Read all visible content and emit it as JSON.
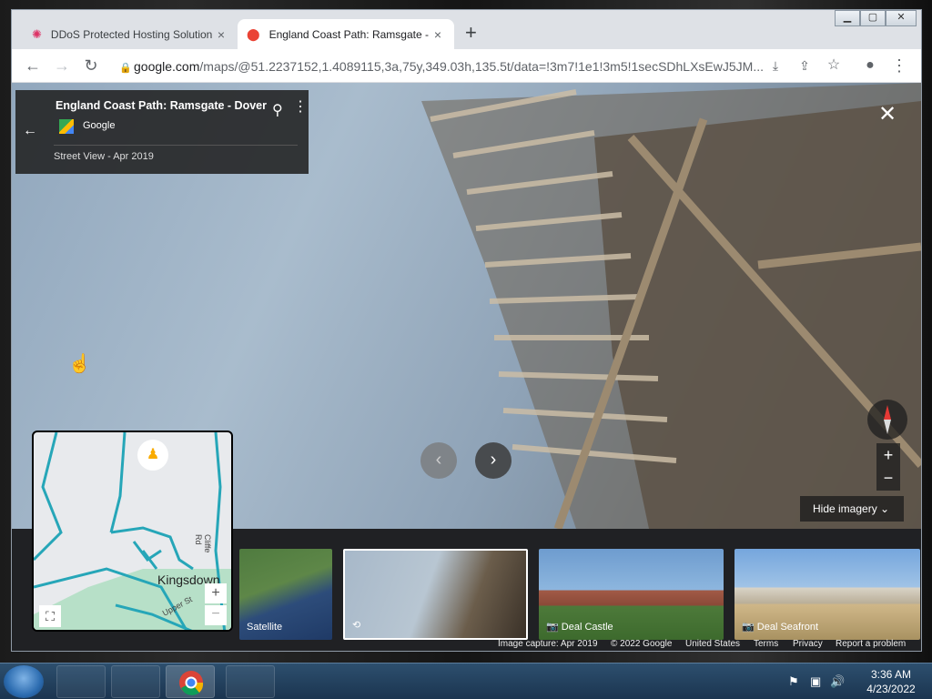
{
  "tabs": [
    {
      "title": "DDoS Protected Hosting Solution",
      "icon": "ddos-site-icon"
    },
    {
      "title": "England Coast Path: Ramsgate - D",
      "icon": "google-maps-icon"
    }
  ],
  "toolbar": {
    "url_host": "google.com",
    "url_path": "/maps/@51.2237152,1.4089115,3a,75y,349.03h,135.5t/data=!3m7!1e1!3m5!1secSDhLXsEwJ5JM..."
  },
  "info_card": {
    "title": "England Coast Path: Ramsgate - Dover",
    "source": "Google",
    "date": "Street View - Apr 2019"
  },
  "controls": {
    "hide_imagery": "Hide imagery",
    "zoom_in": "+",
    "zoom_out": "−"
  },
  "minimap": {
    "place": "Kingsdown",
    "road1": "Cliffe Rd",
    "road2": "Upper St"
  },
  "thumbnails": [
    {
      "label": "Satellite"
    },
    {
      "label": ""
    },
    {
      "label": "Deal Castle"
    },
    {
      "label": "Deal Seafront"
    }
  ],
  "footer": {
    "capture": "Image capture: Apr 2019",
    "copyright": "© 2022 Google",
    "country": "United States",
    "terms": "Terms",
    "privacy": "Privacy",
    "report": "Report a problem"
  },
  "taskbar": {
    "time": "3:36 AM",
    "date": "4/23/2022"
  },
  "colors": {
    "accent": "#1a73e8",
    "panel": "#212121"
  }
}
